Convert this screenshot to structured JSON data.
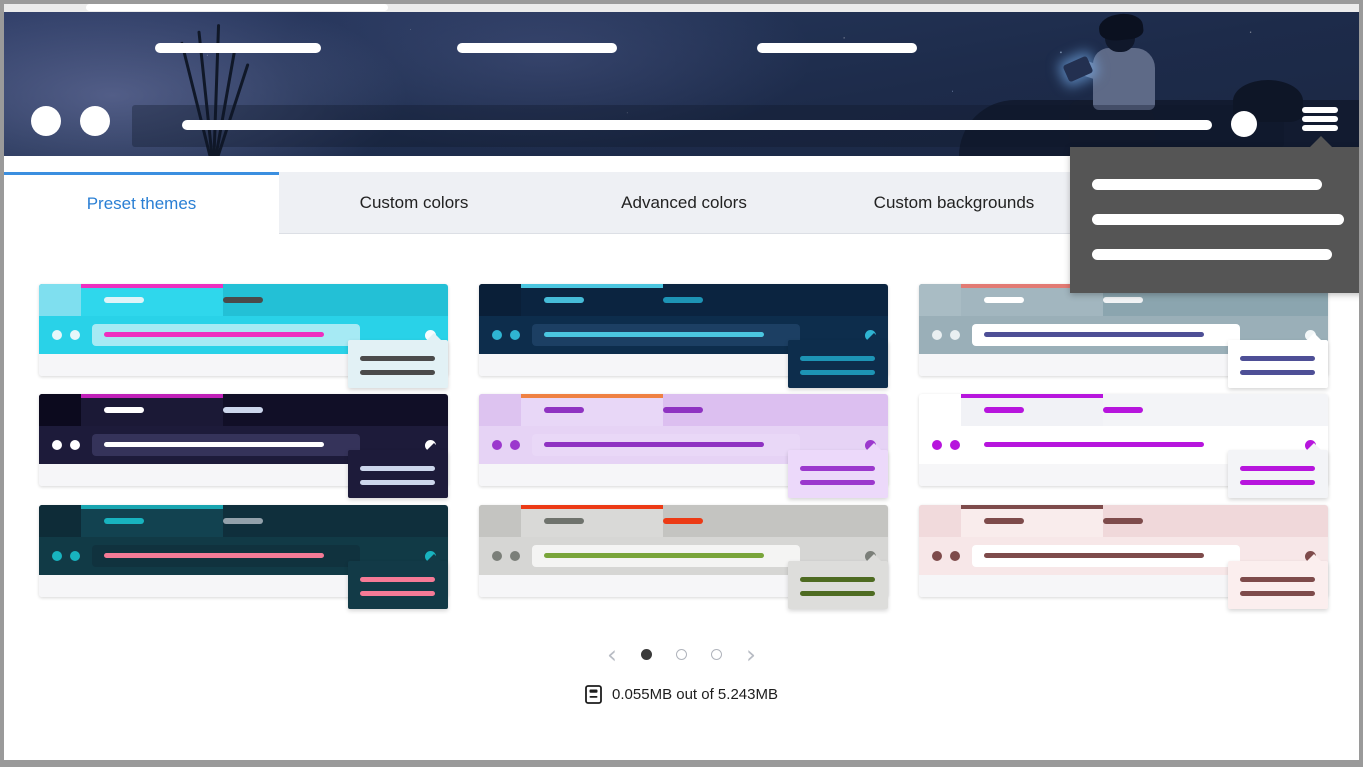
{
  "window": {
    "top_strip_redacted": true
  },
  "hero": {
    "background_image": "night-sky-boy-reading",
    "nav_redacted_items": [
      {
        "name": "nav-item-1",
        "redacted": true
      },
      {
        "name": "nav-item-2",
        "redacted": true
      },
      {
        "name": "nav-item-3",
        "redacted": true
      }
    ],
    "left_circles": 2,
    "search_placeholder_redacted": true,
    "avatar": "user-avatar",
    "hamburger": "hamburger-menu-icon"
  },
  "menu": {
    "open": true,
    "background": "#555555",
    "items": [
      {
        "name": "menu-item-1",
        "redacted": true
      },
      {
        "name": "menu-item-2",
        "redacted": true
      },
      {
        "name": "menu-item-3",
        "redacted": true
      }
    ]
  },
  "tabs": {
    "active_index": 0,
    "active_color": "#2a7fd4",
    "items": [
      {
        "label": "Preset themes"
      },
      {
        "label": "Custom colors"
      },
      {
        "label": "Advanced colors"
      },
      {
        "label": "Custom backgrounds"
      }
    ]
  },
  "themes": [
    {
      "name": "cyan-magenta",
      "chrome": "#29d2e8",
      "chrome_dark": "#23c0d6",
      "stub": "#7fdfef",
      "accent": "#ee2fc0",
      "tab_active_bg": "#2fd7ec",
      "pill_a": "#dff4f8",
      "pill_b": "#4a4a4a",
      "dot": "#e6f7fa",
      "url_bg": "#a6eaf4",
      "url_text": "#ee2fc0",
      "profile": "#f6fdff",
      "pop_bg": "#e2f1f5",
      "pop_line": "#4a4a4a"
    },
    {
      "name": "midnight-cyan",
      "chrome": "#0d2d4c",
      "chrome_dark": "#0b2440",
      "stub": "#0a1f38",
      "accent": "#4bc6e0",
      "tab_active_bg": "#123css",
      "pill_a": "#46bcd8",
      "pill_b": "#1d94b5",
      "dot": "#2fb4d2",
      "url_bg": "#1c3f63",
      "url_text": "#4bc6e0",
      "profile": "#2fb4d2",
      "pop_bg": "#0d2d4c",
      "pop_line": "#1d94b5"
    },
    {
      "name": "slate-indigo",
      "chrome": "#9aafb8",
      "chrome_dark": "#8ba5af",
      "stub": "#a9bcc4",
      "accent": "#e27b74",
      "tab_active_bg": "#a2b6bf",
      "pill_a": "#ffffff",
      "pill_b": "#f2f4f6",
      "dot": "#e9eff1",
      "url_bg": "#ffffff",
      "url_text": "#4e4f96",
      "profile": "#f3f7f8",
      "pop_bg": "#ffffff",
      "pop_line": "#4e4f96"
    },
    {
      "name": "dark-violet",
      "chrome": "#1d1b3a",
      "chrome_dark": "#110f27",
      "stub": "#0c0a1e",
      "accent": "#c020b8",
      "tab_active_bg": "#1b1936",
      "pill_a": "#ffffff",
      "pill_b": "#ccd6ec",
      "dot": "#ffffff",
      "url_bg": "#35335a",
      "url_text": "#ffffff",
      "profile": "#ffffff",
      "pop_bg": "#1d1b3a",
      "pop_line": "#ccd6ec"
    },
    {
      "name": "lavender-orange",
      "chrome": "#e6d3f5",
      "chrome_dark": "#dcbff0",
      "stub": "#ddc3f0",
      "accent": "#ef8143",
      "tab_active_bg": "#e8d7f7",
      "pill_a": "#8f33c2",
      "pill_b": "#8f33c2",
      "dot": "#9b38cd",
      "url_bg": "#e9d8f7",
      "url_text": "#8f33c2",
      "profile": "#9b38cd",
      "pop_bg": "#ecd9fa",
      "pop_line": "#9b38cd"
    },
    {
      "name": "white-purple",
      "chrome": "#ffffff",
      "chrome_dark": "#f3f4f7",
      "stub": "#ffffff",
      "accent": "#b715dd",
      "tab_active_bg": "#f1f2f6",
      "pill_a": "#b715dd",
      "pill_b": "#b715dd",
      "dot": "#b715dd",
      "url_bg": "#ffffff",
      "url_text": "#b715dd",
      "profile": "#b715dd",
      "pop_bg": "#f3f4f7",
      "pop_line": "#b715dd"
    },
    {
      "name": "teal-pink",
      "chrome": "#113a46",
      "chrome_dark": "#0f2f3c",
      "stub": "#0e2c38",
      "accent": "#18a5b0",
      "tab_active_bg": "#124250",
      "pill_a": "#18b3bf",
      "pill_b": "#93a1ab",
      "dot": "#18b3bf",
      "url_bg": "#10323e",
      "url_text": "#f57a96",
      "profile": "#18b3bf",
      "pop_bg": "#123a47",
      "pop_line": "#f57a96"
    },
    {
      "name": "gray-green",
      "chrome": "#d6d6d4",
      "chrome_dark": "#c4c4c1",
      "stub": "#c4c4c1",
      "accent": "#ec3a15",
      "tab_active_bg": "#d9d9d7",
      "pill_a": "#6f736d",
      "pill_b": "#ec3a15",
      "dot": "#7b7f79",
      "url_bg": "#f4f4f3",
      "url_text": "#79a53a",
      "profile": "#7b7f79",
      "pop_bg": "#dddddb",
      "pop_line": "#4e6b22"
    },
    {
      "name": "blush-maroon",
      "chrome": "#f7e7e8",
      "chrome_dark": "#f0d8da",
      "stub": "#f1dadc",
      "accent": "#7e4b4b",
      "tab_active_bg": "#f9ecec",
      "pill_a": "#7e4b4b",
      "pill_b": "#7e4b4b",
      "dot": "#7e4b4b",
      "url_bg": "#ffffff",
      "url_text": "#7e4b4b",
      "profile": "#7e4b4b",
      "pop_bg": "#fbeeee",
      "pop_line": "#7e4b4b"
    }
  ],
  "pagination": {
    "prev_label": "‹",
    "next_label": "›",
    "total_pages": 3,
    "active_page": 1
  },
  "storage": {
    "icon": "database-icon",
    "text": "0.055MB out of 5.243MB",
    "used_mb": 0.055,
    "total_mb": 5.243
  }
}
